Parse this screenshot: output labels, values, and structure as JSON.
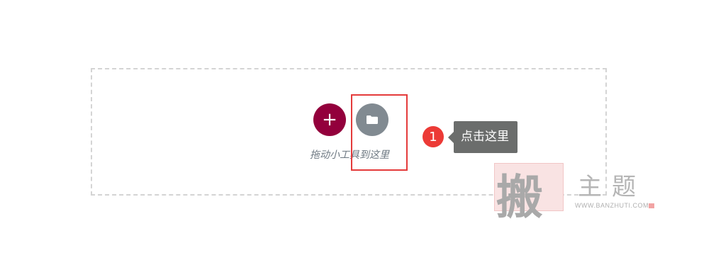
{
  "drop_zone": {
    "add_button_symbol": "+",
    "template_button_icon": "folder-icon",
    "hint": "拖动小工具到这里"
  },
  "annotation": {
    "step_number": "1",
    "tooltip": "点击这里",
    "highlight_color": "#e43b3b"
  },
  "watermark": {
    "seal_char": "搬",
    "title": "主题",
    "url": "WWW.BANZHUTI.COM"
  },
  "colors": {
    "add_button": "#93003c",
    "template_button": "#818a91",
    "badge": "#ec3a36",
    "tooltip_bg": "#6b6d6c"
  }
}
